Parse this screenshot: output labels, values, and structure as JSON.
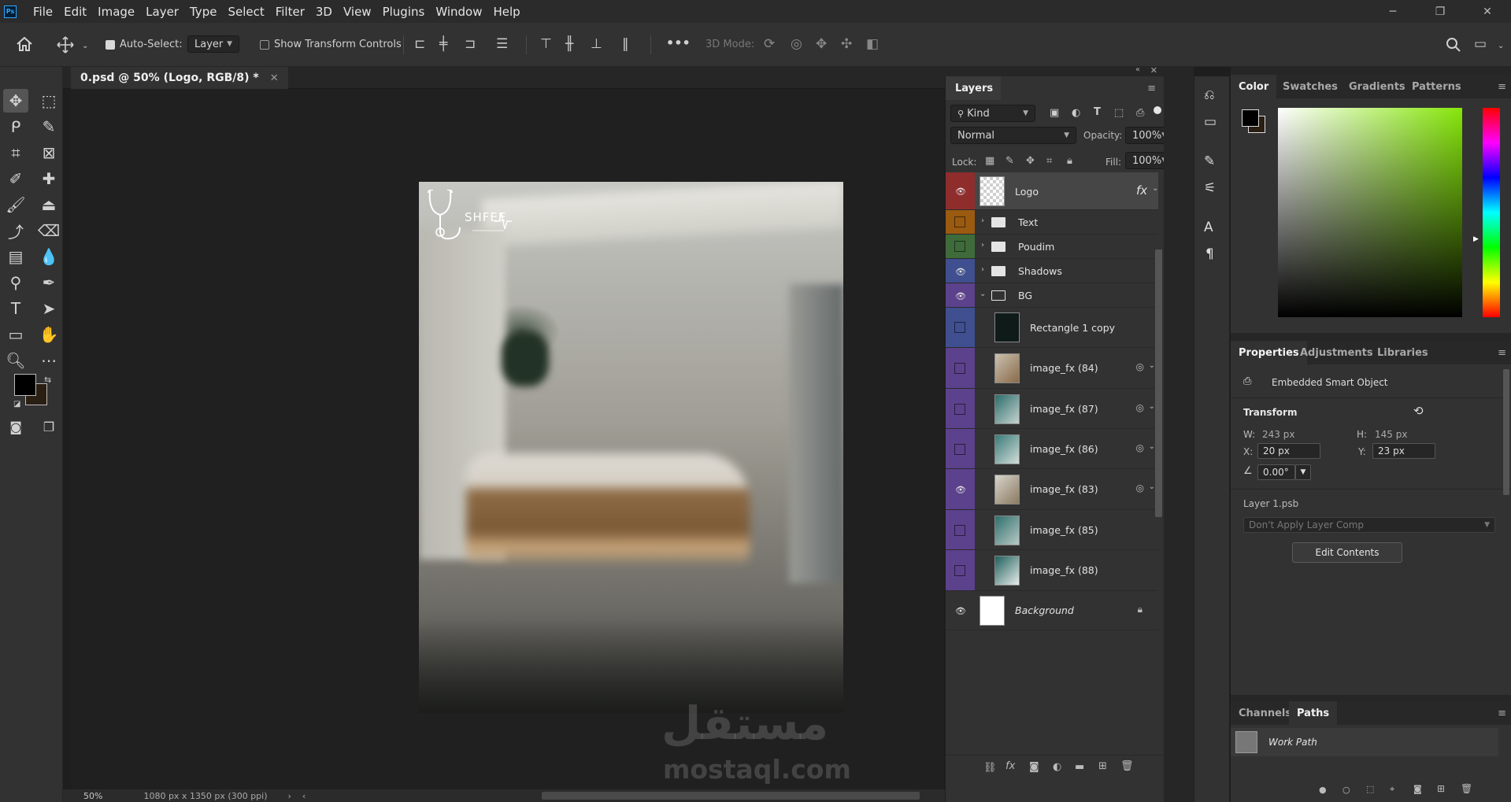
{
  "app": {
    "logo": "Ps",
    "menu": [
      "File",
      "Edit",
      "Image",
      "Layer",
      "Type",
      "Select",
      "Filter",
      "3D",
      "View",
      "Plugins",
      "Window",
      "Help"
    ],
    "window_controls": [
      "─",
      "❐",
      "✕"
    ]
  },
  "options_bar": {
    "auto_select_label": "Auto-Select:",
    "auto_select_checked": true,
    "auto_select_target": "Layer",
    "show_transform_label": "Show Transform Controls",
    "show_transform_checked": false,
    "mode_3d_label": "3D Mode:",
    "more_label": "•••"
  },
  "document": {
    "tab_title": "0.psd @ 50% (Logo, RGB/8) *",
    "tab_close": "✕",
    "logo_text": "SHFEE",
    "zoom": "50%",
    "doc_info": "1080 px x 1350 px (300 ppi)"
  },
  "watermark": {
    "arabic": "مستقل",
    "latin": "mostaql.com"
  },
  "layers_panel": {
    "title": "Layers",
    "filter_kind": "Kind",
    "blend_mode": "Normal",
    "opacity_label": "Opacity:",
    "opacity_value": "100%",
    "lock_label": "Lock:",
    "fill_label": "Fill:",
    "fill_value": "100%",
    "layers": [
      {
        "name": "Logo",
        "visible": true,
        "color": "#8f2d2d",
        "kind": "smart",
        "fx": "fx",
        "selected": true
      },
      {
        "name": "Text",
        "visible": false,
        "color": "#9a5a10",
        "kind": "group"
      },
      {
        "name": "Poudim",
        "visible": false,
        "color": "#3f6b3a",
        "kind": "group"
      },
      {
        "name": "Shadows",
        "visible": true,
        "color": "#3f4f8f",
        "kind": "group"
      },
      {
        "name": "BG",
        "visible": true,
        "color": "#5c418c",
        "kind": "group-open"
      },
      {
        "name": "Rectangle 1 copy",
        "visible": false,
        "color": "#3f4f8f",
        "kind": "shape"
      },
      {
        "name": "image_fx (84)",
        "visible": false,
        "color": "#5c418c",
        "kind": "image"
      },
      {
        "name": "image_fx (87)",
        "visible": false,
        "color": "#5c418c",
        "kind": "image"
      },
      {
        "name": "image_fx (86)",
        "visible": false,
        "color": "#5c418c",
        "kind": "image"
      },
      {
        "name": "image_fx (83)",
        "visible": true,
        "color": "#5c418c",
        "kind": "image"
      },
      {
        "name": "image_fx (85)",
        "visible": false,
        "color": "#5c418c",
        "kind": "image"
      },
      {
        "name": "image_fx (88)",
        "visible": false,
        "color": "#5c418c",
        "kind": "image"
      },
      {
        "name": "Background",
        "visible": true,
        "color": "",
        "kind": "background"
      }
    ]
  },
  "color_panel": {
    "tabs": [
      "Color",
      "Swatches",
      "Gradients",
      "Patterns"
    ]
  },
  "properties_panel": {
    "tabs": [
      "Properties",
      "Adjustments",
      "Libraries"
    ],
    "object_type": "Embedded Smart Object",
    "transform_label": "Transform",
    "w_label": "W:",
    "w_value": "243 px",
    "h_label": "H:",
    "h_value": "145 px",
    "x_label": "X:",
    "x_value": "20 px",
    "y_label": "Y:",
    "y_value": "23 px",
    "angle_value": "0.00°",
    "linked_file": "Layer 1.psb",
    "layer_comp_placeholder": "Don't Apply Layer Comp",
    "edit_contents_label": "Edit Contents"
  },
  "paths_panel": {
    "tabs": [
      "Channels",
      "Paths"
    ],
    "work_path": "Work Path"
  },
  "colors": {
    "accent": "#31a8ff",
    "foreground": "#000000",
    "background": "#2b1e12"
  }
}
